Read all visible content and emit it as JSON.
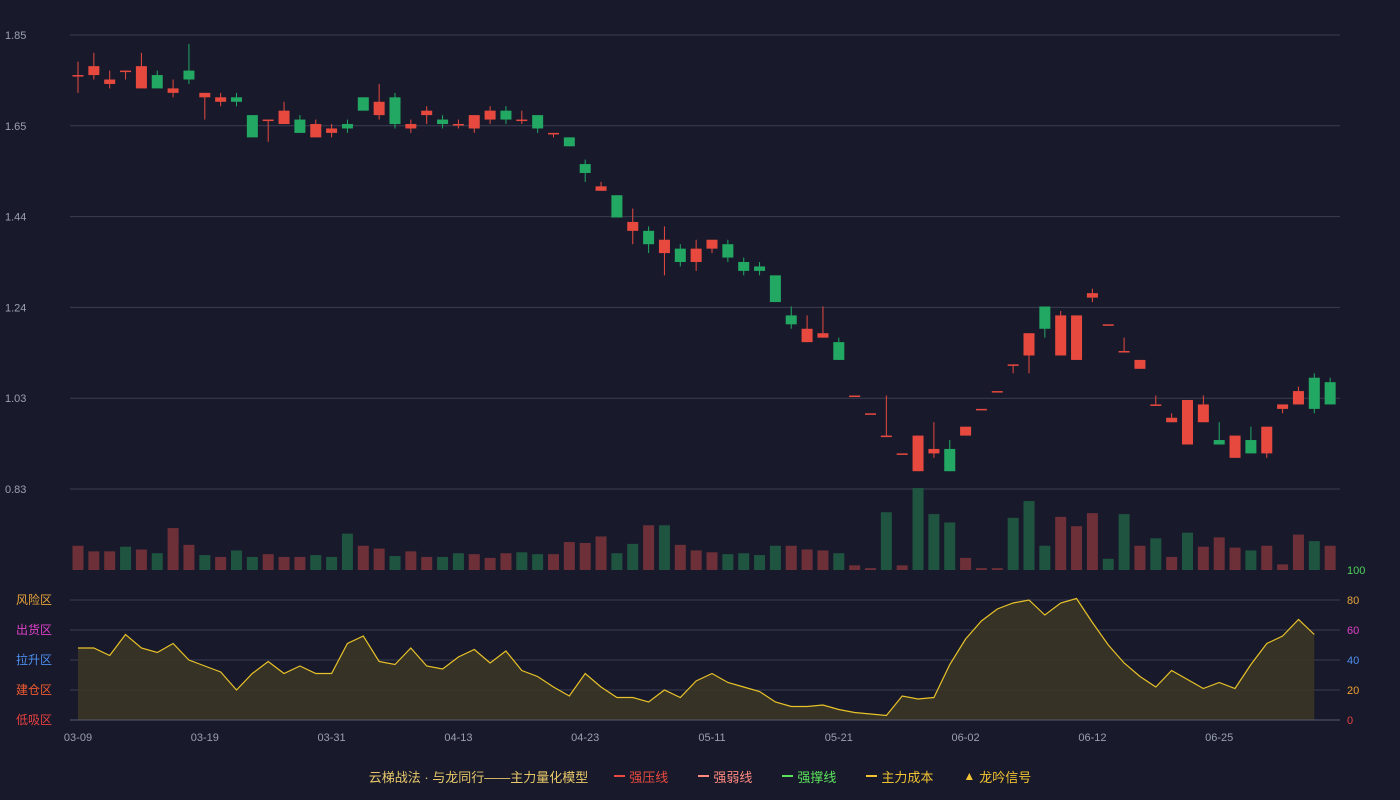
{
  "colors": {
    "background": "#181a2b",
    "up": "#e8493f",
    "down": "#22a862",
    "grid": "#3a3d52",
    "axis_text": "#9aa0b0",
    "model_line": "#e8c229",
    "model_fill": "#3a3526"
  },
  "chart_data": [
    {
      "type": "candlestick",
      "ylim": [
        0.73,
        1.85
      ],
      "y_ticks": [
        "1.85",
        "1.65",
        "1.44",
        "1.24",
        "1.03",
        "0.83"
      ],
      "candles": [
        [
          1.76,
          1.76,
          1.79,
          1.72
        ],
        [
          1.76,
          1.78,
          1.81,
          1.75
        ],
        [
          1.74,
          1.75,
          1.77,
          1.73
        ],
        [
          1.77,
          1.77,
          1.77,
          1.75
        ],
        [
          1.73,
          1.78,
          1.81,
          1.73
        ],
        [
          1.76,
          1.73,
          1.77,
          1.73
        ],
        [
          1.72,
          1.73,
          1.75,
          1.71
        ],
        [
          1.77,
          1.75,
          1.83,
          1.74
        ],
        [
          1.71,
          1.72,
          1.72,
          1.66
        ],
        [
          1.7,
          1.71,
          1.72,
          1.69
        ],
        [
          1.71,
          1.7,
          1.72,
          1.69
        ],
        [
          1.67,
          1.62,
          1.67,
          1.62
        ],
        [
          1.66,
          1.66,
          1.66,
          1.61
        ],
        [
          1.65,
          1.68,
          1.7,
          1.65
        ],
        [
          1.66,
          1.63,
          1.67,
          1.63
        ],
        [
          1.62,
          1.65,
          1.66,
          1.62
        ],
        [
          1.63,
          1.64,
          1.65,
          1.62
        ],
        [
          1.65,
          1.64,
          1.66,
          1.63
        ],
        [
          1.71,
          1.68,
          1.71,
          1.68
        ],
        [
          1.67,
          1.7,
          1.74,
          1.66
        ],
        [
          1.71,
          1.65,
          1.72,
          1.64
        ],
        [
          1.64,
          1.65,
          1.66,
          1.63
        ],
        [
          1.67,
          1.68,
          1.69,
          1.65
        ],
        [
          1.66,
          1.65,
          1.67,
          1.64
        ],
        [
          1.65,
          1.65,
          1.66,
          1.64
        ],
        [
          1.64,
          1.67,
          1.67,
          1.63
        ],
        [
          1.66,
          1.68,
          1.69,
          1.65
        ],
        [
          1.68,
          1.66,
          1.69,
          1.65
        ],
        [
          1.66,
          1.66,
          1.68,
          1.65
        ],
        [
          1.67,
          1.64,
          1.67,
          1.63
        ],
        [
          1.63,
          1.63,
          1.63,
          1.62
        ],
        [
          1.62,
          1.6,
          1.62,
          1.6
        ],
        [
          1.56,
          1.54,
          1.57,
          1.52
        ],
        [
          1.5,
          1.51,
          1.52,
          1.5
        ],
        [
          1.49,
          1.44,
          1.49,
          1.44
        ],
        [
          1.41,
          1.43,
          1.46,
          1.38
        ],
        [
          1.41,
          1.38,
          1.42,
          1.36
        ],
        [
          1.36,
          1.39,
          1.42,
          1.31
        ],
        [
          1.37,
          1.34,
          1.38,
          1.33
        ],
        [
          1.34,
          1.37,
          1.39,
          1.32
        ],
        [
          1.37,
          1.39,
          1.39,
          1.36
        ],
        [
          1.38,
          1.35,
          1.39,
          1.34
        ],
        [
          1.34,
          1.32,
          1.35,
          1.31
        ],
        [
          1.33,
          1.32,
          1.34,
          1.31
        ],
        [
          1.31,
          1.25,
          1.31,
          1.25
        ],
        [
          1.22,
          1.2,
          1.24,
          1.19
        ],
        [
          1.16,
          1.19,
          1.22,
          1.16
        ],
        [
          1.17,
          1.18,
          1.24,
          1.17
        ],
        [
          1.16,
          1.12,
          1.17,
          1.12
        ],
        [
          1.04,
          1.04,
          1.04,
          1.04
        ],
        [
          1.0,
          1.0,
          1.0,
          1.0
        ],
        [
          0.95,
          0.95,
          1.04,
          0.95
        ],
        [
          0.91,
          0.91,
          0.91,
          0.91
        ],
        [
          0.87,
          0.95,
          0.95,
          0.87
        ],
        [
          0.91,
          0.92,
          0.98,
          0.9
        ],
        [
          0.92,
          0.87,
          0.94,
          0.87
        ],
        [
          0.95,
          0.97,
          0.97,
          0.95
        ],
        [
          1.01,
          1.01,
          1.01,
          1.01
        ],
        [
          1.05,
          1.05,
          1.05,
          1.05
        ],
        [
          1.11,
          1.11,
          1.11,
          1.09
        ],
        [
          1.13,
          1.18,
          1.18,
          1.09
        ],
        [
          1.24,
          1.19,
          1.24,
          1.17
        ],
        [
          1.13,
          1.22,
          1.23,
          1.13
        ],
        [
          1.12,
          1.22,
          1.22,
          1.12
        ],
        [
          1.26,
          1.27,
          1.28,
          1.25
        ],
        [
          1.2,
          1.2,
          1.2,
          1.2
        ],
        [
          1.14,
          1.14,
          1.17,
          1.14
        ],
        [
          1.1,
          1.12,
          1.12,
          1.1
        ],
        [
          1.02,
          1.02,
          1.04,
          1.02
        ],
        [
          0.98,
          0.99,
          1.0,
          0.98
        ],
        [
          0.93,
          1.03,
          1.03,
          0.93
        ],
        [
          0.98,
          1.02,
          1.04,
          0.98
        ],
        [
          0.94,
          0.93,
          0.98,
          0.93
        ],
        [
          0.9,
          0.95,
          0.95,
          0.9
        ],
        [
          0.94,
          0.91,
          0.97,
          0.91
        ],
        [
          0.91,
          0.97,
          0.97,
          0.9
        ],
        [
          1.01,
          1.02,
          1.02,
          1.0
        ],
        [
          1.02,
          1.05,
          1.06,
          1.02
        ],
        [
          1.08,
          1.01,
          1.09,
          1.0
        ],
        [
          1.07,
          1.02,
          1.08,
          1.02
        ]
      ]
    },
    {
      "type": "bar",
      "label": "volume",
      "values": [
        26,
        20,
        20,
        25,
        22,
        18,
        45,
        27,
        16,
        14,
        21,
        14,
        17,
        14,
        14,
        16,
        14,
        39,
        26,
        23,
        15,
        20,
        14,
        14,
        18,
        17,
        13,
        18,
        19,
        17,
        17,
        30,
        29,
        36,
        18,
        28,
        48,
        48,
        27,
        21,
        19,
        17,
        18,
        16,
        26,
        26,
        22,
        21,
        18,
        5,
        2,
        62,
        5,
        88,
        60,
        51,
        13,
        2,
        2,
        56,
        74,
        26,
        57,
        47,
        61,
        12,
        60,
        26,
        34,
        14,
        40,
        25,
        35,
        24,
        21,
        26,
        6,
        38,
        31,
        26
      ],
      "up": [
        1,
        1,
        1,
        0,
        1,
        0,
        1,
        1,
        0,
        1,
        0,
        0,
        1,
        1,
        1,
        0,
        0,
        0,
        1,
        1,
        0,
        1,
        1,
        0,
        0,
        1,
        1,
        1,
        0,
        0,
        1,
        1,
        1,
        1,
        0,
        0,
        1,
        0,
        1,
        1,
        1,
        0,
        0,
        0,
        0,
        1,
        1,
        1,
        0,
        1,
        1,
        0,
        1,
        0,
        0,
        0,
        1,
        1,
        1,
        0,
        0,
        0,
        1,
        1,
        1,
        0,
        0,
        1,
        0,
        1,
        0,
        1,
        1,
        1,
        0,
        1,
        1,
        1,
        0,
        1
      ]
    },
    {
      "type": "area",
      "label": "主力量化模型",
      "ylim": [
        0,
        100
      ],
      "y_ticks": [
        "100",
        "80",
        "60",
        "40",
        "20",
        "0"
      ],
      "zones": [
        "风险区",
        "出货区",
        "拉升区",
        "建仓区",
        "低吸区"
      ],
      "values": [
        48,
        48,
        43,
        57,
        48,
        45,
        51,
        40,
        36,
        32,
        20,
        31,
        39,
        31,
        36,
        31,
        31,
        51,
        56,
        39,
        37,
        48,
        36,
        34,
        42,
        47,
        38,
        46,
        33,
        29,
        22,
        16,
        31,
        22,
        15,
        15,
        12,
        20,
        15,
        26,
        31,
        25,
        22,
        19,
        12,
        9,
        9,
        10,
        7,
        5,
        4,
        3,
        16,
        14,
        15,
        37,
        54,
        66,
        74,
        78,
        80,
        70,
        78,
        81,
        65,
        50,
        38,
        29,
        22,
        33,
        27,
        21,
        25,
        21,
        37,
        51,
        56,
        67,
        57
      ]
    },
    {
      "x_ticks": [
        "03-09",
        "03-19",
        "03-31",
        "04-13",
        "04-23",
        "05-11",
        "05-21",
        "06-02",
        "06-12",
        "06-25"
      ]
    }
  ],
  "legend": {
    "title": "云梯战法 · 与龙同行——主力量化模型",
    "items": [
      {
        "label": "强压线",
        "symbol": "solid",
        "color": "#e8493f"
      },
      {
        "label": "强弱线",
        "symbol": "dashed",
        "color": "#ff8a80"
      },
      {
        "label": "强撑线",
        "symbol": "solid",
        "color": "#5be25b"
      },
      {
        "label": "主力成本",
        "symbol": "dashed",
        "color": "#f1c232"
      },
      {
        "label": "龙吟信号",
        "symbol": "triangle",
        "color": "#f1c232"
      }
    ]
  }
}
